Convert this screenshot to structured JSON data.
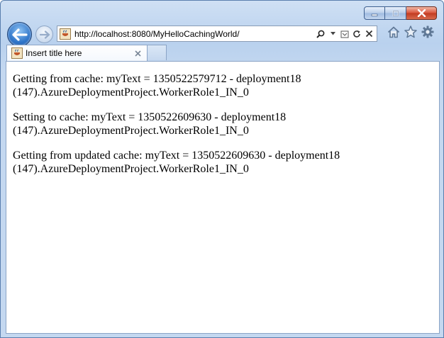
{
  "browser": {
    "address_url": "http://localhost:8080/MyHelloCachingWorld/",
    "tab_title": "Insert title here"
  },
  "icons": {
    "back": "back-arrow-icon",
    "forward": "forward-arrow-icon",
    "favicon": "java-cup-favicon-icon",
    "search": "search-icon",
    "dropdown": "chevron-down-icon",
    "compat": "compatibility-view-icon",
    "refresh": "refresh-icon",
    "stop": "stop-icon",
    "home": "home-icon",
    "favorites": "star-icon",
    "tools": "gear-icon",
    "tab_close": "close-icon",
    "minimize": "minimize-icon",
    "maximize": "maximize-icon",
    "close": "close-window-icon"
  },
  "page": {
    "lines": [
      "Getting from cache: myText = 1350522579712 - deployment18 (147).AzureDeploymentProject.WorkerRole1_IN_0",
      "Setting to cache: myText = 1350522609630 - deployment18 (147).AzureDeploymentProject.WorkerRole1_IN_0",
      "Getting from updated cache: myText = 1350522609630 - deployment18 (147).AzureDeploymentProject.WorkerRole1_IN_0"
    ]
  }
}
